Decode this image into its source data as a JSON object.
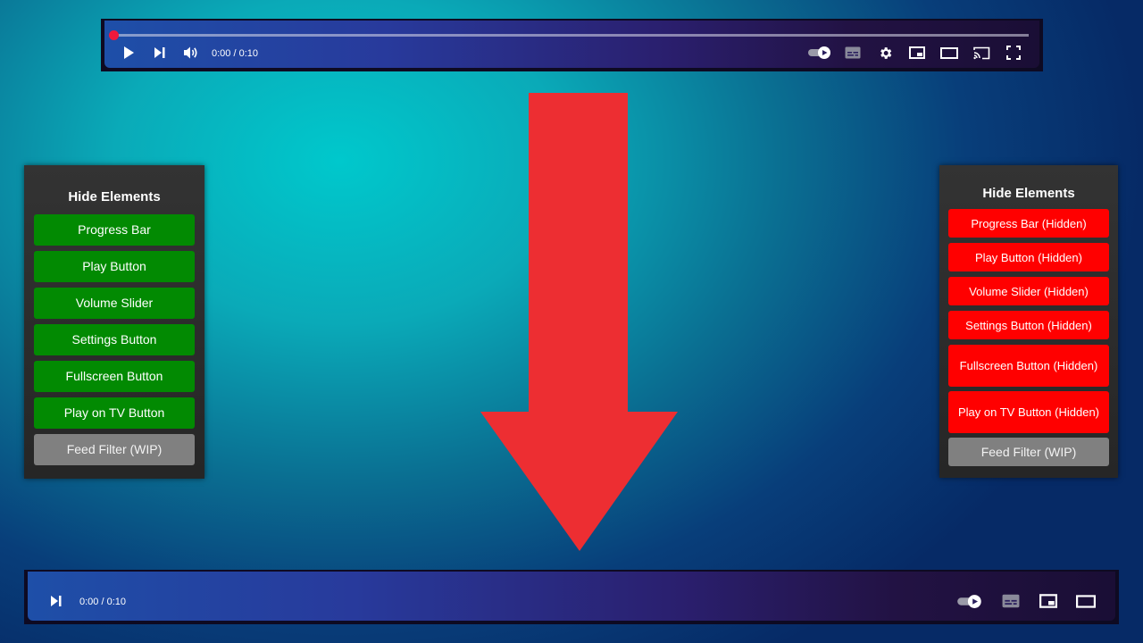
{
  "colors": {
    "enabled_button": "#028a02",
    "hidden_button": "#ff0000",
    "wip_button": "#808080",
    "arrow": "#ed2e32",
    "progress_dot": "#f0193c"
  },
  "player_before": {
    "time": "0:00 / 0:10",
    "icons": [
      "play-icon",
      "next-icon",
      "volume-icon",
      "autoplay-toggle-icon",
      "subtitles-icon",
      "settings-icon",
      "miniplayer-icon",
      "theater-mode-icon",
      "cast-icon",
      "fullscreen-icon"
    ]
  },
  "player_after": {
    "time": "0:00 / 0:10",
    "icons": [
      "next-icon",
      "autoplay-toggle-icon",
      "subtitles-icon",
      "miniplayer-icon",
      "theater-mode-icon"
    ]
  },
  "panel_before": {
    "title": "Hide Elements",
    "buttons": [
      {
        "label": "Progress Bar"
      },
      {
        "label": "Play Button"
      },
      {
        "label": "Volume Slider"
      },
      {
        "label": "Settings Button"
      },
      {
        "label": "Fullscreen Button"
      },
      {
        "label": "Play on TV Button"
      },
      {
        "label": "Feed Filter (WIP)"
      }
    ]
  },
  "panel_after": {
    "title": "Hide Elements",
    "buttons": [
      {
        "label": "Progress Bar (Hidden)"
      },
      {
        "label": "Play Button (Hidden)"
      },
      {
        "label": "Volume Slider (Hidden)"
      },
      {
        "label": "Settings Button (Hidden)"
      },
      {
        "label": "Fullscreen Button (Hidden)"
      },
      {
        "label": "Play on TV Button (Hidden)"
      },
      {
        "label": "Feed Filter (WIP)"
      }
    ]
  }
}
